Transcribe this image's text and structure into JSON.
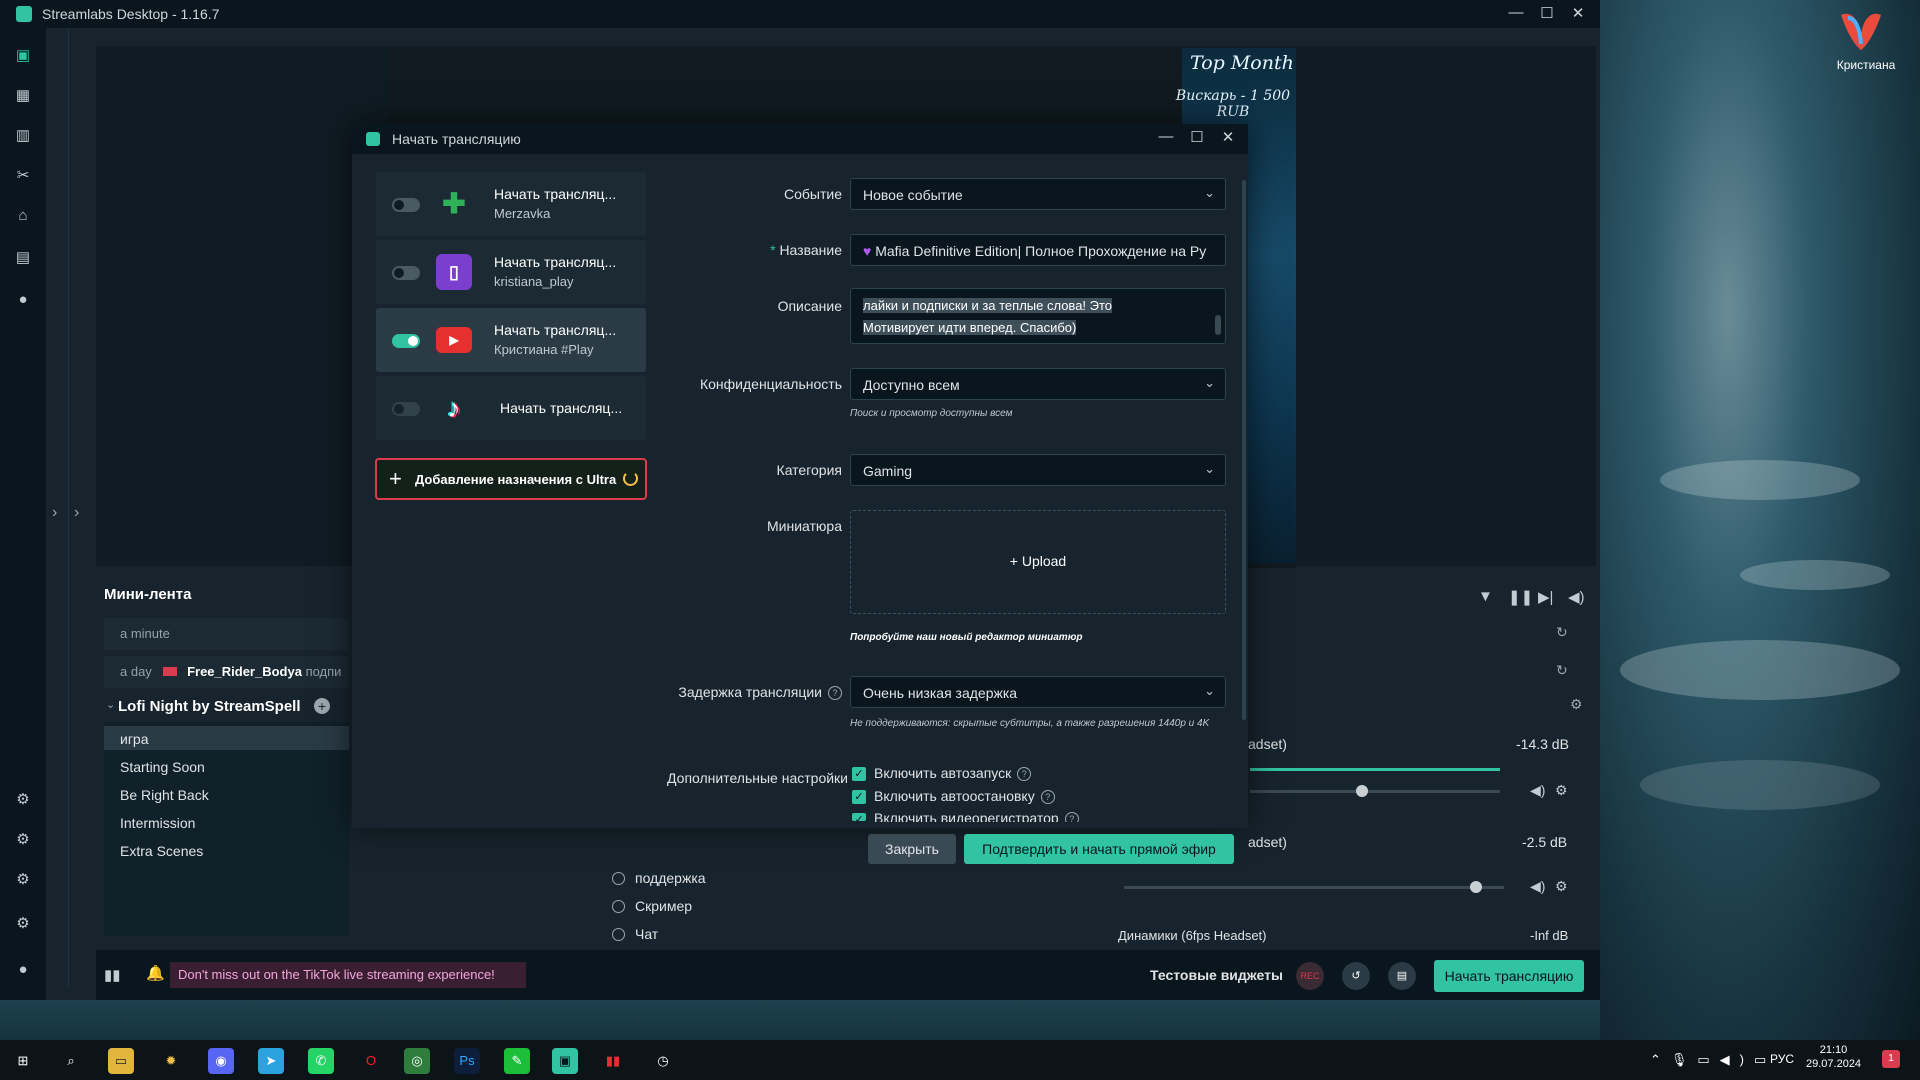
{
  "app": {
    "title": "Streamlabs Desktop - 1.16.7"
  },
  "desktop": {
    "user_label": "Кристиана"
  },
  "preview": {
    "overlay_title": "Top Month",
    "overlay_line": "Вискарь - 1 500 RUB"
  },
  "mini_feed": {
    "title": "Мини-лента",
    "rows": [
      {
        "time": "a minute",
        "name": "",
        "action": ""
      },
      {
        "time": "a day",
        "name": "Free_Rider_Bodya",
        "action": "подпи"
      }
    ]
  },
  "scenes": {
    "collection": "Lofi Night by StreamSpell",
    "items": [
      "игра",
      "Starting Soon",
      "Be Right Back",
      "Intermission",
      "Extra Scenes"
    ]
  },
  "sources": [
    "поддержка",
    "Скример",
    "Чат"
  ],
  "mixer": {
    "ch1": {
      "label": "adset)",
      "db": "-14.3 dB"
    },
    "ch2": {
      "label": "adset)",
      "db": "-2.5 dB"
    },
    "ch3": {
      "label": "Динамики (6fps Headset)",
      "db": "-Inf dB"
    }
  },
  "footer": {
    "banner": "Don't miss out on the TikTok live streaming experience!",
    "test_widgets": "Тестовые виджеты",
    "rec": "REC",
    "start_button": "Начать трансляцию"
  },
  "modal": {
    "title": "Начать трансляцию",
    "destinations": [
      {
        "line1": "Начать трансляц...",
        "line2": "Merzavka",
        "on": false,
        "platform": "trovo"
      },
      {
        "line1": "Начать трансляц...",
        "line2": "kristiana_play",
        "on": false,
        "platform": "twitch"
      },
      {
        "line1": "Начать трансляц...",
        "line2": "Кристиана #Play",
        "on": true,
        "platform": "youtube"
      },
      {
        "line1": "Начать трансляц...",
        "line2": "",
        "on": false,
        "platform": "tiktok"
      }
    ],
    "add_destination": "Добавление назначения с Ultra",
    "fields": {
      "event_label": "Событие",
      "event_value": "Новое событие",
      "name_label": "Название",
      "name_value": "Mafia Definitive Edition| Полное Прохождение на Ру",
      "desc_label": "Описание",
      "desc_line1": "лайки и подписки и за теплые слова! Это",
      "desc_line2": "Мотивирует идти вперед. Спасибо)",
      "privacy_label": "Конфиденциальность",
      "privacy_value": "Доступно всем",
      "privacy_hint": "Поиск и просмотр доступны всем",
      "category_label": "Категория",
      "category_value": "Gaming",
      "thumb_label": "Миниатюра",
      "upload": "+ Upload",
      "thumb_hint": "Попробуйте наш новый редактор миниатюр",
      "latency_label": "Задержка трансляции",
      "latency_value": "Очень низкая задержка",
      "latency_hint": "Не поддерживаются: скрытые субтитры, а также разрешения 1440p и 4K",
      "extra_label": "Дополнительные настройки",
      "check1": "Включить автозапуск",
      "check2": "Включить автоостановку",
      "check3": "Включить видеорегистратор"
    },
    "close": "Закрыть",
    "confirm": "Подтвердить и начать прямой эфир"
  },
  "taskbar": {
    "lang": "РУС",
    "time": "21:10",
    "date": "29.07.2024"
  },
  "colors": {
    "accent": "#31c3a2",
    "bg": "#17242d",
    "panel": "#09161d",
    "red": "#d93c4f"
  }
}
